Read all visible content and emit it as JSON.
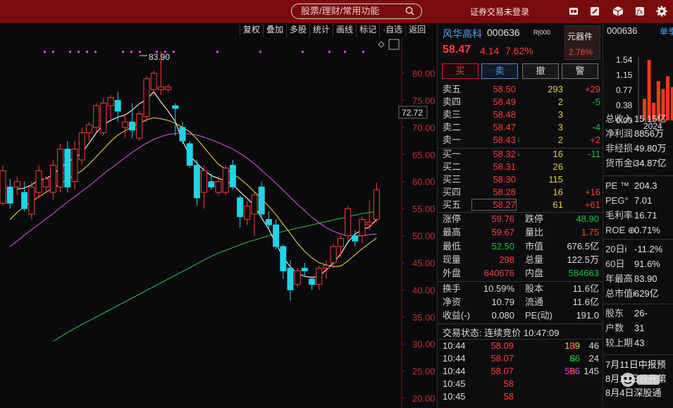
{
  "topbar": {
    "search_placeholder": "股票/理财/常用功能",
    "status": "证券交易未登录",
    "icons": [
      "notes-icon",
      "edit-icon",
      "cube-icon",
      "formula-icon",
      "gear-icon"
    ],
    "bg": "#7a0b0d"
  },
  "toolbar": {
    "items": [
      "复权",
      "叠加",
      "多股",
      "统计",
      "画线",
      "标记",
      "·自选",
      "返回"
    ]
  },
  "chart": {
    "price_axis": [
      "80.00",
      "75.00",
      "70.00",
      "65.00",
      "60.00",
      "55.00",
      "50.00",
      "45.00",
      "40.00",
      "35.00",
      "30.00",
      "25.00",
      "20.00"
    ],
    "high_label": "83.90",
    "cursor_price": "72.72",
    "colors": {
      "up": "#ff3b3b",
      "down": "#22d3e6",
      "ma5": "#ffffff",
      "ma10": "#e8d04a",
      "ma20": "#d14fd1",
      "ma60": "#2fb34a"
    }
  },
  "chart_data": {
    "type": "candlestick",
    "ylim": [
      18,
      88
    ],
    "candles": [
      {
        "o": 56,
        "h": 63.0,
        "l": 55.5,
        "c": 62.0
      },
      {
        "o": 59,
        "h": 60.5,
        "l": 55.0,
        "c": 56.0
      },
      {
        "o": 59,
        "h": 61.0,
        "l": 57.5,
        "c": 60.0
      },
      {
        "o": 58,
        "h": 60.0,
        "l": 54.5,
        "c": 55.0
      },
      {
        "o": 54,
        "h": 60.0,
        "l": 53.0,
        "c": 59.0
      },
      {
        "o": 58,
        "h": 63.0,
        "l": 57.0,
        "c": 62.0
      },
      {
        "o": 59,
        "h": 61.0,
        "l": 58.0,
        "c": 60.5
      },
      {
        "o": 58,
        "h": 64.0,
        "l": 56.5,
        "c": 63.0
      },
      {
        "o": 59,
        "h": 67.0,
        "l": 58.0,
        "c": 66.0
      },
      {
        "o": 66,
        "h": 67.5,
        "l": 58.0,
        "c": 59.0
      },
      {
        "o": 60,
        "h": 67.5,
        "l": 58.5,
        "c": 66.0
      },
      {
        "o": 64,
        "h": 70.0,
        "l": 63.0,
        "c": 69.0
      },
      {
        "o": 69,
        "h": 71.0,
        "l": 67.5,
        "c": 70.5
      },
      {
        "o": 70,
        "h": 74.5,
        "l": 69.0,
        "c": 74.0
      },
      {
        "o": 69,
        "h": 75.5,
        "l": 68.5,
        "c": 74.5
      },
      {
        "o": 74,
        "h": 76.0,
        "l": 71.5,
        "c": 75.5
      },
      {
        "o": 75,
        "h": 76.5,
        "l": 71.0,
        "c": 73.0
      },
      {
        "o": 70,
        "h": 72.5,
        "l": 68.0,
        "c": 71.0
      },
      {
        "o": 71,
        "h": 74.5,
        "l": 68.0,
        "c": 69.5
      },
      {
        "o": 68,
        "h": 73.0,
        "l": 67.5,
        "c": 72.5
      },
      {
        "o": 72,
        "h": 79.5,
        "l": 71.0,
        "c": 79.0
      },
      {
        "o": 77,
        "h": 80.5,
        "l": 76.0,
        "c": 80.0
      },
      {
        "o": 77,
        "h": 84.0,
        "l": 76.0,
        "c": 77.5
      },
      {
        "o": 77,
        "h": 78.0,
        "l": 76.5,
        "c": 77.5
      },
      {
        "o": 74,
        "h": 74.5,
        "l": 68.5,
        "c": 73.5
      },
      {
        "o": 70,
        "h": 71.0,
        "l": 67.0,
        "c": 67.5
      },
      {
        "o": 67,
        "h": 67.5,
        "l": 62.5,
        "c": 63.0
      },
      {
        "o": 63,
        "h": 64.0,
        "l": 55.5,
        "c": 57.0
      },
      {
        "o": 58,
        "h": 63.0,
        "l": 55.0,
        "c": 62.0
      },
      {
        "o": 60,
        "h": 61.5,
        "l": 58.5,
        "c": 59.0
      },
      {
        "o": 58,
        "h": 61.0,
        "l": 57.5,
        "c": 60.0
      },
      {
        "o": 58,
        "h": 63.0,
        "l": 57.5,
        "c": 62.5
      },
      {
        "o": 63,
        "h": 64.0,
        "l": 58.5,
        "c": 59.0
      },
      {
        "o": 57,
        "h": 57.5,
        "l": 51.5,
        "c": 53.5
      },
      {
        "o": 53,
        "h": 56.5,
        "l": 52.0,
        "c": 55.5
      },
      {
        "o": 54,
        "h": 58.0,
        "l": 50.0,
        "c": 57.5
      },
      {
        "o": 59,
        "h": 60.0,
        "l": 53.0,
        "c": 54.0
      },
      {
        "o": 53,
        "h": 54.5,
        "l": 51.0,
        "c": 52.0
      },
      {
        "o": 52,
        "h": 53.0,
        "l": 47.5,
        "c": 48.0
      },
      {
        "o": 48,
        "h": 48.5,
        "l": 42.0,
        "c": 43.5
      },
      {
        "o": 44,
        "h": 45.5,
        "l": 38.0,
        "c": 40.0
      },
      {
        "o": 41,
        "h": 44.0,
        "l": 40.5,
        "c": 43.5
      },
      {
        "o": 44,
        "h": 45.0,
        "l": 42.5,
        "c": 43.5
      },
      {
        "o": 42,
        "h": 42.5,
        "l": 40.0,
        "c": 41.0
      },
      {
        "o": 41,
        "h": 44.5,
        "l": 40.0,
        "c": 44.0
      },
      {
        "o": 44,
        "h": 45.5,
        "l": 42.0,
        "c": 44.5
      },
      {
        "o": 45,
        "h": 48.5,
        "l": 44.0,
        "c": 48.0
      },
      {
        "o": 48,
        "h": 50.0,
        "l": 46.0,
        "c": 49.5
      },
      {
        "o": 50,
        "h": 55.5,
        "l": 49.0,
        "c": 55.0
      },
      {
        "o": 50,
        "h": 51.0,
        "l": 48.0,
        "c": 49.0
      },
      {
        "o": 50,
        "h": 53.5,
        "l": 48.5,
        "c": 53.0
      },
      {
        "o": 52,
        "h": 56.5,
        "l": 51.0,
        "c": 52.5
      },
      {
        "o": 53,
        "h": 59.8,
        "l": 52.5,
        "c": 58.5
      }
    ],
    "ma5": [
      58.6,
      58.8,
      59.4,
      60.3,
      60.5,
      61.4,
      62.5,
      63.6,
      64.4,
      65.3,
      67.1,
      69.0,
      70.5,
      71.3,
      71.9,
      72.3,
      73.2,
      74.4,
      75.1,
      76.6,
      74.7,
      73.0,
      71.1,
      67.5,
      64.8,
      63.4,
      62.1,
      61.1,
      60.6,
      60.1,
      59.5,
      58.1,
      56.9,
      55.5,
      53.3,
      51.2,
      48.5,
      46.1,
      44.2,
      43.0,
      42.5,
      42.3,
      42.5,
      43.7,
      45.0,
      46.6,
      48.8,
      50.3,
      51.1,
      51.6,
      53.0
    ],
    "ma10": [
      53.0,
      54.3,
      55.4,
      56.3,
      57.2,
      58.0,
      58.8,
      59.6,
      60.4,
      61.2,
      62.0,
      63.2,
      64.6,
      66.0,
      67.4,
      68.6,
      69.4,
      70.1,
      70.8,
      71.4,
      71.8,
      71.6,
      71.3,
      70.8,
      70.0,
      69.2,
      67.9,
      66.3,
      64.7,
      63.2,
      62.3,
      61.5,
      60.5,
      59.4,
      58.1,
      56.9,
      55.4,
      53.9,
      52.1,
      50.4,
      48.6,
      47.1,
      45.9,
      45.0,
      44.6,
      44.3,
      44.4,
      45.3,
      46.5,
      47.6,
      48.6,
      49.6
    ],
    "ma20": [
      48.0,
      49.0,
      50.1,
      51.1,
      52.1,
      53.1,
      54.1,
      55.2,
      56.2,
      57.2,
      58.2,
      59.2,
      60.3,
      61.4,
      62.4,
      63.4,
      64.4,
      65.4,
      66.3,
      67.1,
      67.8,
      68.3,
      68.7,
      68.9,
      68.9,
      68.8,
      68.6,
      68.2,
      67.7,
      67.2,
      66.6,
      66.0,
      65.2,
      64.3,
      63.3,
      62.1,
      60.9,
      59.7,
      58.4,
      57.1,
      55.8,
      54.6,
      53.4,
      52.4,
      51.5,
      50.8,
      50.3,
      50.0,
      49.9,
      50.0,
      50.2,
      50.3
    ],
    "ma60": [
      30.5,
      31.3,
      32.1,
      32.9,
      33.6,
      34.3,
      35.0,
      35.7,
      36.4,
      37.1,
      37.8,
      38.5,
      39.2,
      39.9,
      40.6,
      41.3,
      42.0,
      42.7,
      43.4,
      44.1,
      44.8,
      45.5,
      46.2,
      46.8,
      47.3,
      47.8,
      48.3,
      48.8,
      49.2,
      49.6,
      50.0,
      50.4,
      50.8,
      51.1,
      51.4,
      51.7,
      52.0,
      52.3,
      52.6,
      52.9,
      53.2,
      53.5,
      53.8,
      54.1,
      54.3,
      54.4
    ]
  },
  "quote": {
    "name": "风华高科",
    "code": "000636",
    "tag": "R|000",
    "price": "58.47",
    "change": "4.14",
    "change_pct": "7.62%",
    "sector": {
      "name": "元器件",
      "pct": "2.78%"
    },
    "buttons": {
      "buy": "买",
      "sell": "卖",
      "cancel": "撤",
      "alert": "警"
    },
    "asks": [
      {
        "label": "卖五",
        "price": "58.50",
        "vol": "293",
        "delta": "+29",
        "delta_color": "red"
      },
      {
        "label": "卖四",
        "price": "58.49",
        "vol": "2",
        "delta": "-5",
        "delta_color": "green"
      },
      {
        "label": "卖三",
        "price": "58.48",
        "vol": "3",
        "delta": "",
        "delta_color": "red"
      },
      {
        "label": "卖二",
        "price": "58.47",
        "vol": "3",
        "delta": "-4",
        "delta_color": "green"
      },
      {
        "label": "卖一",
        "price": "58.43",
        "vol": "2",
        "delta": "+2",
        "delta_color": "red"
      }
    ],
    "bids": [
      {
        "label": "买一",
        "price": "58.32",
        "vol": "16",
        "delta": "-11",
        "delta_color": "green"
      },
      {
        "label": "买二",
        "price": "58.31",
        "vol": "26",
        "delta": "",
        "delta_color": "red"
      },
      {
        "label": "买三",
        "price": "58.30",
        "vol": "115",
        "delta": "",
        "delta_color": "red"
      },
      {
        "label": "买四",
        "price": "58.28",
        "vol": "16",
        "delta": "+16",
        "delta_color": "red"
      },
      {
        "label": "买五",
        "price": "58.27",
        "vol": "61",
        "delta": "+61",
        "delta_color": "red"
      }
    ],
    "stats": [
      {
        "k1": "涨停",
        "v1": "59.76",
        "c1": "red",
        "k2": "跌停",
        "v2": "48.90",
        "c2": "green"
      },
      {
        "k1": "最高",
        "v1": "59.67",
        "c1": "red",
        "k2": "量比",
        "v2": "1.75",
        "c2": "red"
      },
      {
        "k1": "最低",
        "v1": "52.50",
        "c1": "green",
        "k2": "市值",
        "v2": "676.5亿",
        "c2": "white"
      },
      {
        "k1": "现量",
        "v1": "298",
        "c1": "red",
        "k2": "总量",
        "v2": "122.5万",
        "c2": "white"
      },
      {
        "k1": "外盘",
        "v1": "640676",
        "c1": "red",
        "k2": "内盘",
        "v2": "584663",
        "c2": "green"
      }
    ],
    "stats2": [
      {
        "k1": "换手",
        "v1": "10.59%",
        "k2": "股本",
        "v2": "11.6亿"
      },
      {
        "k1": "净资",
        "v1": "10.79",
        "k2": "流通",
        "v2": "11.6亿"
      },
      {
        "k1": "收益(-)",
        "v1": "0.080",
        "k2": "PE(动)",
        "v2": "191.0"
      }
    ],
    "trade_status": "交易状态: 连续竞价 10:47:09",
    "ticks": [
      {
        "time": "10:44",
        "price": "58.09",
        "vol": "139",
        "side": "B",
        "num": "46"
      },
      {
        "time": "10:44",
        "price": "58.07",
        "vol": "66",
        "side": "S",
        "num": "24"
      },
      {
        "time": "10:44",
        "price": "58.07",
        "vol": "566",
        "side": "B",
        "num": "145"
      },
      {
        "time": "10:45",
        "price": "58",
        "vol": "",
        "side": "",
        "num": ""
      },
      {
        "time": "10:45",
        "price": "58",
        "vol": "",
        "side": "",
        "num": ""
      }
    ]
  },
  "fin": {
    "code": "000636",
    "tab": "单季",
    "bars_year": "2024",
    "bar_axis": [
      "1.54",
      "1.15",
      "0.77",
      "0.38",
      "0.00"
    ],
    "bar_values": [
      0.55,
      1.54,
      0.45,
      1.0,
      0.8,
      1.12,
      0.85
    ],
    "rows1": [
      {
        "k": "总收入",
        "v": "15.15亿"
      },
      {
        "k": "净利润",
        "v": "8856万"
      },
      {
        "k": "非经损",
        "v": "49.80万"
      },
      {
        "k": "货币金i",
        "v": "34.87亿"
      }
    ],
    "rows2": [
      {
        "k": "PE ™",
        "v": "204.3"
      },
      {
        "k": "PEG°",
        "v": "7.01"
      },
      {
        "k": "毛利率",
        "v": "16.71"
      },
      {
        "k": "ROE ⊕",
        "v": "0.71%"
      }
    ],
    "rows3": [
      {
        "k": "20日i",
        "v": "-11.2%"
      },
      {
        "k": "60日",
        "v": "91.6%"
      },
      {
        "k": "年最高",
        "v": "83.90"
      },
      {
        "k": "总市值i",
        "v": "629亿"
      }
    ],
    "rows4": [
      {
        "k": "股东",
        "v": "26-"
      },
      {
        "k": "户数",
        "v": "31"
      },
      {
        "k": "较上期",
        "v": "43"
      }
    ],
    "notes": [
      "7月11日中报预",
      "8月12日召开第",
      "8月4日深股通"
    ]
  }
}
